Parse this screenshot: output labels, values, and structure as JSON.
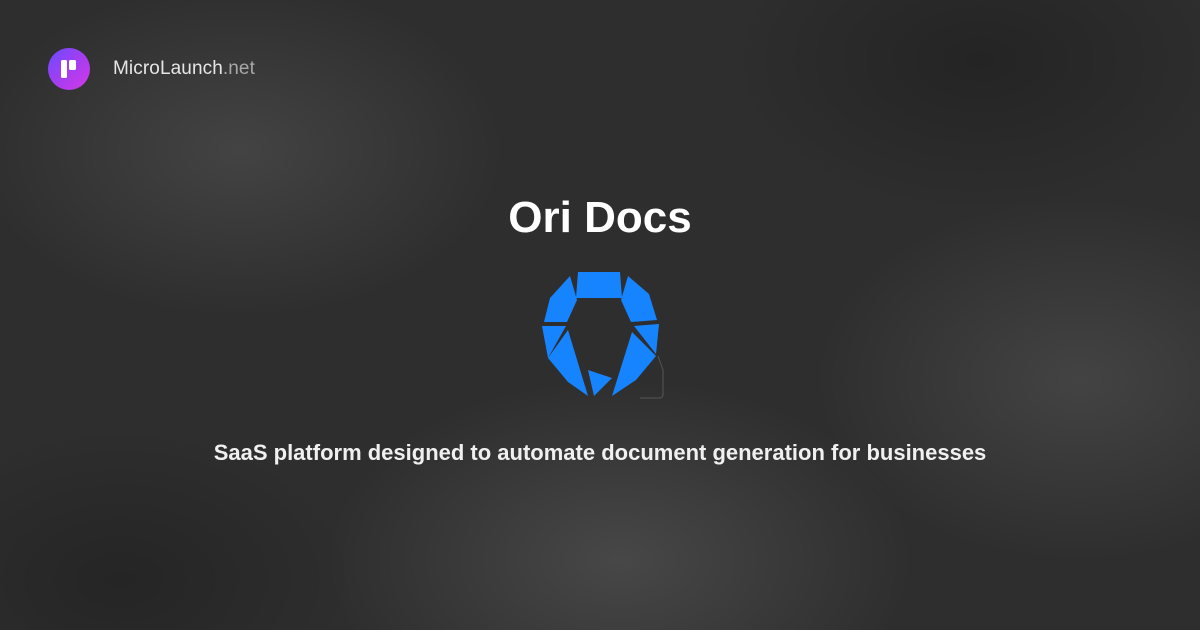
{
  "brand": {
    "name_main": "MicroLaunch",
    "name_tld": ".net",
    "logo_icon": "microlaunch-logo-icon",
    "logo_gradient": [
      "#6a4cff",
      "#d43ae8"
    ]
  },
  "product": {
    "title": "Ori Docs",
    "logo_icon": "ori-docs-logo-icon",
    "logo_color": "#1784ff",
    "tagline": "SaaS platform designed to automate document generation for businesses"
  }
}
